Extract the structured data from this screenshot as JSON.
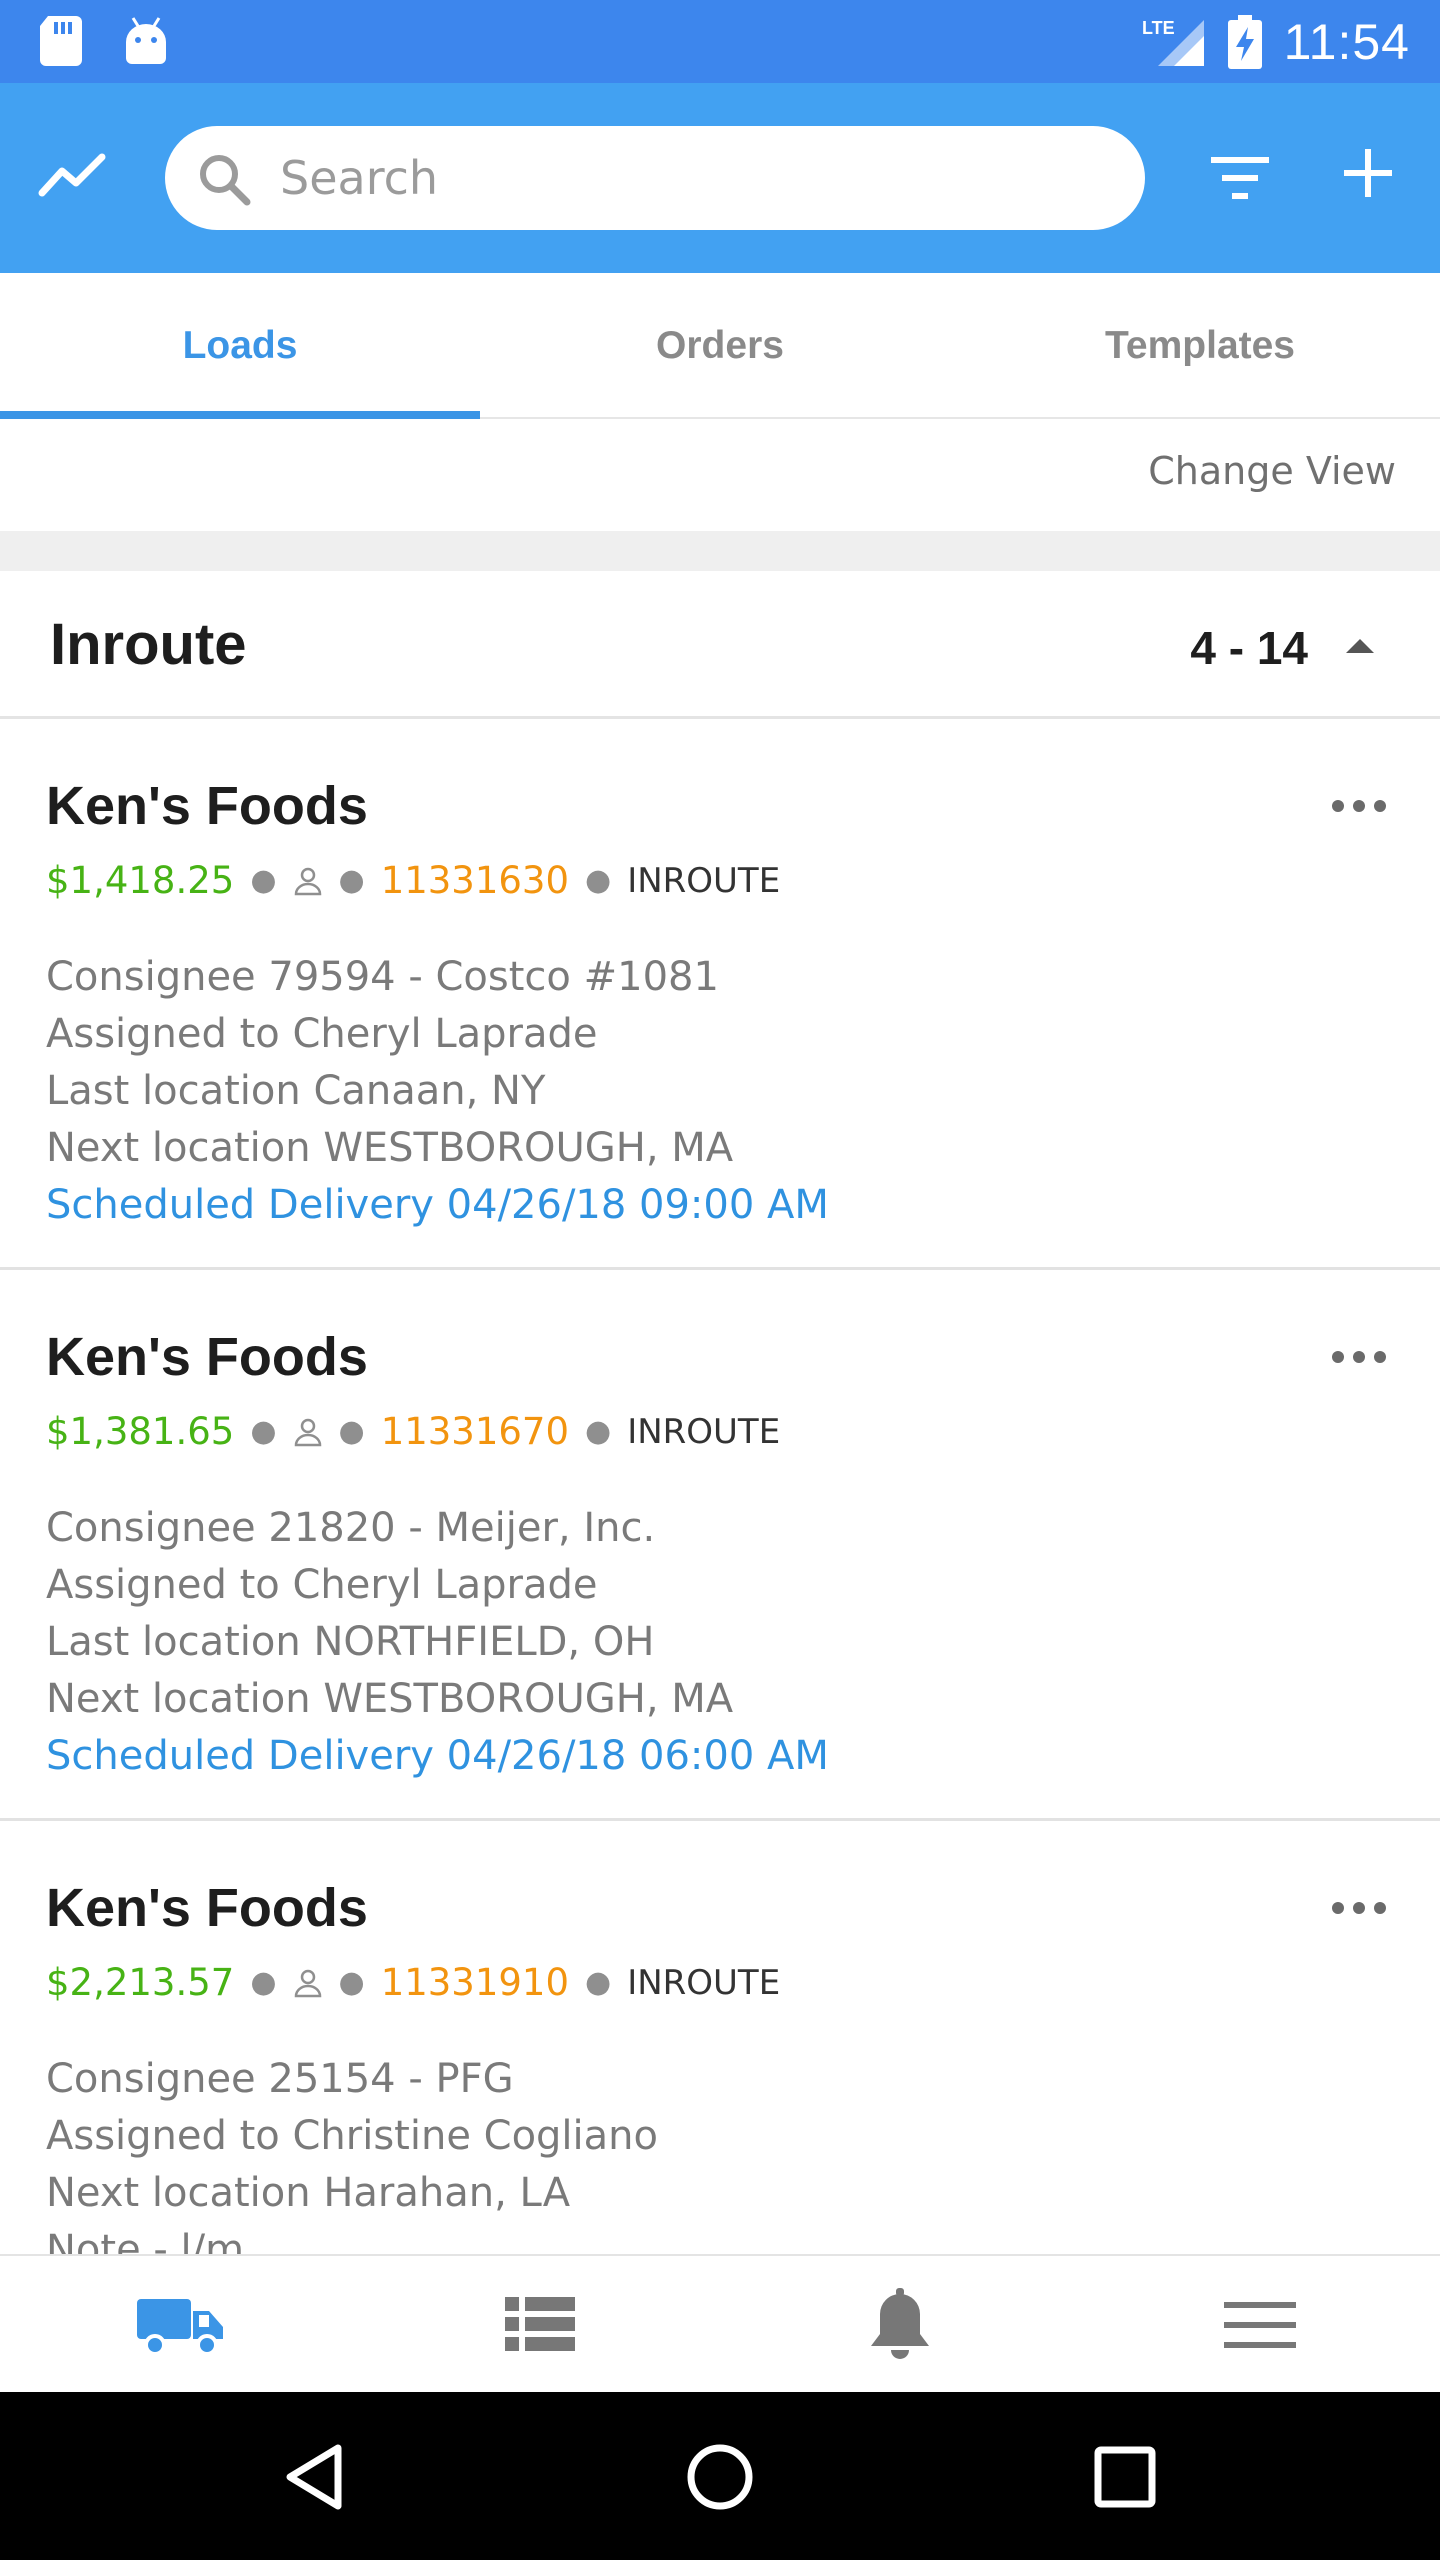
{
  "status_bar": {
    "time": "11:54",
    "network": "LTE"
  },
  "search": {
    "placeholder": "Search"
  },
  "tabs": [
    {
      "label": "Loads",
      "active": true
    },
    {
      "label": "Orders",
      "active": false
    },
    {
      "label": "Templates",
      "active": false
    }
  ],
  "change_view_label": "Change View",
  "section": {
    "title": "Inroute",
    "count": "4 - 14"
  },
  "loads": [
    {
      "customer": "Ken's Foods",
      "amount": "$1,418.25",
      "load_number": "11331630",
      "status": "INROUTE",
      "consignee": "Consignee 79594 - Costco #1081",
      "assigned": "Assigned to Cheryl Laprade",
      "last_location": "Last location Canaan, NY",
      "next_location": "Next location WESTBOROUGH, MA",
      "scheduled": "Scheduled Delivery 04/26/18 09:00 AM"
    },
    {
      "customer": "Ken's Foods",
      "amount": "$1,381.65",
      "load_number": "11331670",
      "status": "INROUTE",
      "consignee": "Consignee 21820 - Meijer, Inc.",
      "assigned": "Assigned to Cheryl Laprade",
      "last_location": "Last location NORTHFIELD, OH",
      "next_location": "Next location WESTBOROUGH, MA",
      "scheduled": "Scheduled Delivery 04/26/18 06:00 AM"
    },
    {
      "customer": "Ken's Foods",
      "amount": "$2,213.57",
      "load_number": "11331910",
      "status": "INROUTE",
      "consignee": "Consignee 25154 - PFG",
      "assigned": "Assigned to Christine Cogliano",
      "next_location": "Next location Harahan, LA",
      "note": "Note - l/m"
    }
  ],
  "colors": {
    "status_bar": "#3d86ed",
    "app_bar": "#42a1f2",
    "accent": "#3b95e6",
    "amount": "#47b315",
    "load_number": "#f2940f"
  },
  "icons": {
    "app_bar": [
      "trend-icon",
      "search-icon",
      "filter-icon",
      "add-icon"
    ],
    "bottom_nav": [
      "truck-icon",
      "list-icon",
      "bell-icon",
      "menu-icon"
    ],
    "system_nav": [
      "back-icon",
      "home-icon",
      "recents-icon"
    ]
  }
}
